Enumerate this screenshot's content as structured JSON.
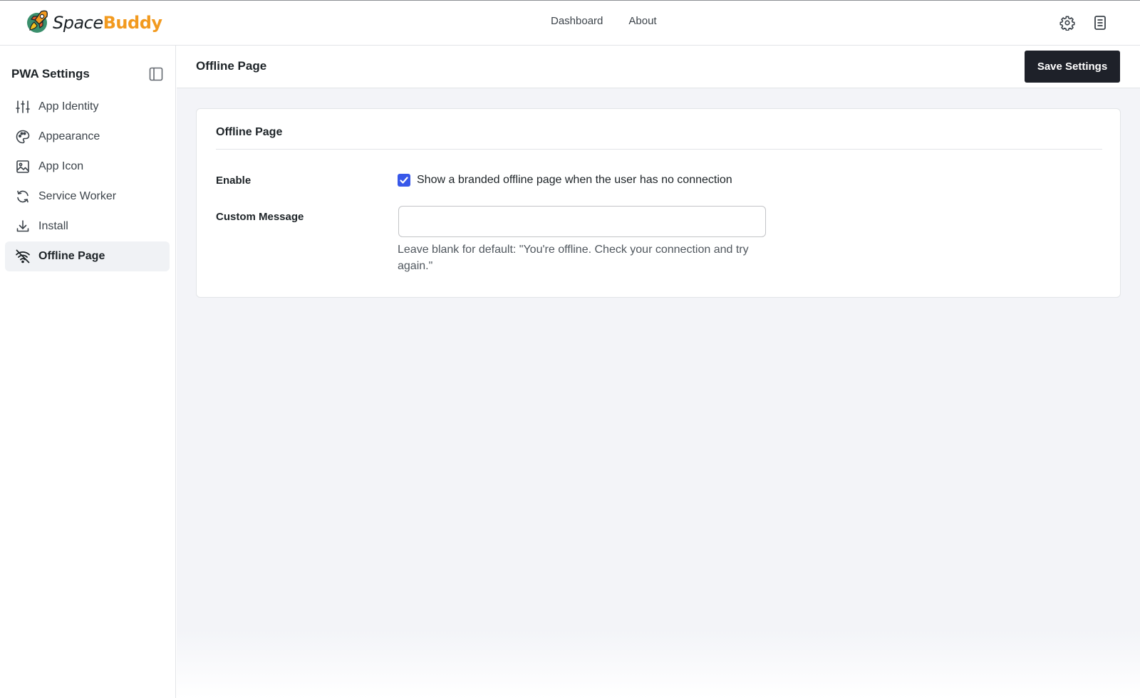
{
  "brand": {
    "name_part1": "Space",
    "name_part2": "Buddy",
    "accent_color": "#f29a1f",
    "logo_icon": "rocket-icon"
  },
  "topnav": {
    "items": [
      "Dashboard",
      "About"
    ]
  },
  "topbar_icons": [
    "gear-icon",
    "document-icon"
  ],
  "sidebar": {
    "title": "PWA Settings",
    "collapse_icon": "sidebar-toggle-icon",
    "items": [
      {
        "label": "App Identity",
        "icon": "sliders-icon",
        "active": false
      },
      {
        "label": "Appearance",
        "icon": "palette-icon",
        "active": false
      },
      {
        "label": "App Icon",
        "icon": "image-icon",
        "active": false
      },
      {
        "label": "Service Worker",
        "icon": "refresh-icon",
        "active": false
      },
      {
        "label": "Install",
        "icon": "download-icon",
        "active": false
      },
      {
        "label": "Offline Page",
        "icon": "wifi-off-icon",
        "active": true
      }
    ]
  },
  "main": {
    "title": "Offline Page",
    "save_label": "Save Settings",
    "card": {
      "title": "Offline Page",
      "enable_label": "Enable",
      "enable_checked": true,
      "enable_text": "Show a branded offline page when the user has no connection",
      "message_label": "Custom Message",
      "message_value": "",
      "message_help": "Leave blank for default: \"You're offline. Check your connection and try again.\""
    }
  },
  "colors": {
    "checkbox": "#3858e9",
    "save_button": "#1e2129",
    "main_background": "#f3f4f8"
  }
}
